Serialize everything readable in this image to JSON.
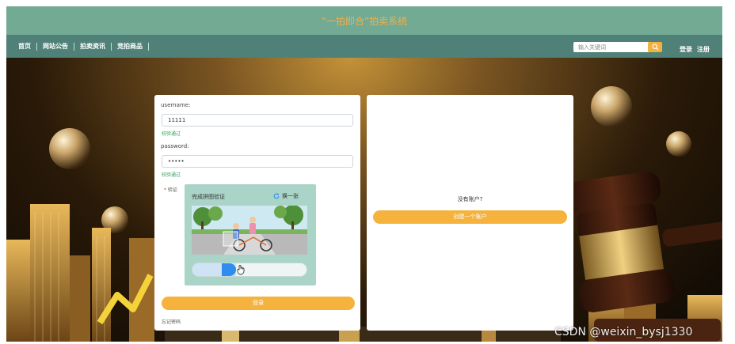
{
  "site": {
    "title": "“一拍即合”拍卖系统"
  },
  "nav": {
    "items": [
      "首页",
      "网站公告",
      "拍卖资讯",
      "竞拍商品"
    ]
  },
  "search": {
    "placeholder": "输入关键词",
    "icon": "search-icon"
  },
  "auth": {
    "login": "登录",
    "register": "注册"
  },
  "login_form": {
    "username_label": "username:",
    "username_value": "11111",
    "username_status": "校验通过",
    "password_label": "password:",
    "password_value": "•••••",
    "password_status": "校验通过",
    "verify_label": "验证",
    "required_mark": "*",
    "captcha": {
      "title": "完成拼图验证",
      "refresh_label": "换一张",
      "slider_progress": 0.29
    },
    "submit_label": "登录",
    "forgot_label": "忘记密码"
  },
  "register_panel": {
    "prompt": "没有账户?",
    "create_label": "创建一个账户"
  },
  "watermark": "CSDN @weixin_bysj1330",
  "colors": {
    "topbar": "#72aa94",
    "navbar": "#4f8178",
    "accent": "#f5b33e",
    "valid": "#3aa05a",
    "captcha_bg": "#a9d4c7",
    "slider_knob": "#2f8df0"
  }
}
